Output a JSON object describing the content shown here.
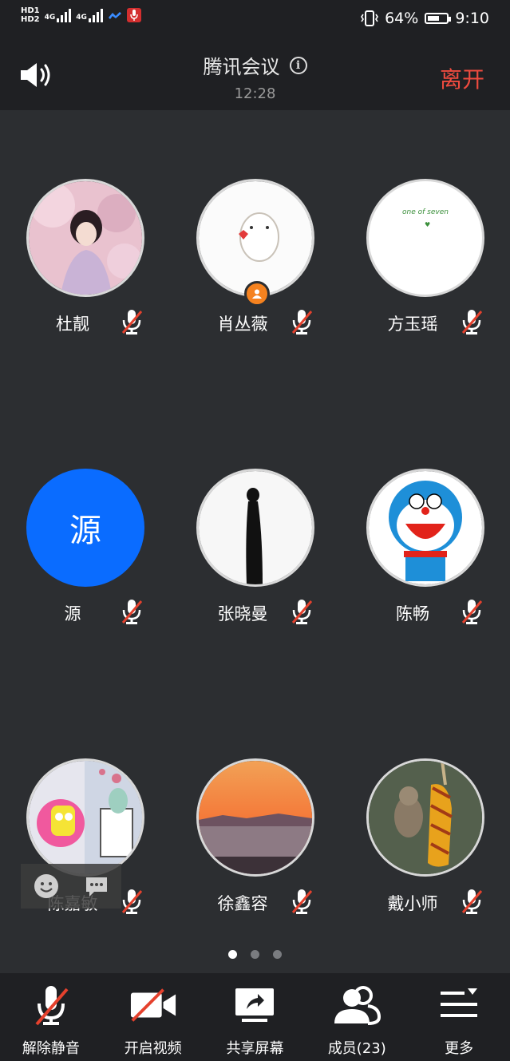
{
  "status_bar": {
    "hd1": "HD1",
    "hd2": "HD2",
    "net1": "4G",
    "net2": "4G",
    "battery": "64%",
    "battery_level": 0.64,
    "time": "9:10"
  },
  "header": {
    "title": "腾讯会议",
    "timer": "12:28",
    "leave": "离开",
    "speaker_icon": "speaker-icon",
    "info_icon": "info-icon"
  },
  "participants": [
    {
      "name": "杜靓",
      "avatar": "photo",
      "muted": true
    },
    {
      "name": "肖丛薇",
      "avatar": "photo",
      "muted": true,
      "host": true
    },
    {
      "name": "方玉瑶",
      "avatar": "photo",
      "avatar_text": "one of seven",
      "muted": true
    },
    {
      "name": "源",
      "avatar": "letter",
      "avatar_text": "源",
      "muted": true
    },
    {
      "name": "张晓曼",
      "avatar": "photo",
      "muted": true
    },
    {
      "name": "陈畅",
      "avatar": "photo",
      "muted": true
    },
    {
      "name": "陈嘉敏",
      "avatar": "photo",
      "muted": true
    },
    {
      "name": "徐鑫容",
      "avatar": "photo",
      "muted": true
    },
    {
      "name": "戴小师",
      "avatar": "photo",
      "muted": true
    }
  ],
  "pagination": {
    "pages": 3,
    "current": 1
  },
  "toolbar": {
    "unmute": "解除静音",
    "video": "开启视频",
    "share": "共享屏幕",
    "members": "成员(23)",
    "more": "更多"
  },
  "colors": {
    "background": "#2c2e31",
    "bar": "#1f2023",
    "leave": "#ef4b3f",
    "mute_slash": "#e5412d",
    "letter_avatar": "#0a6cff",
    "host_badge": "#f5821f"
  }
}
